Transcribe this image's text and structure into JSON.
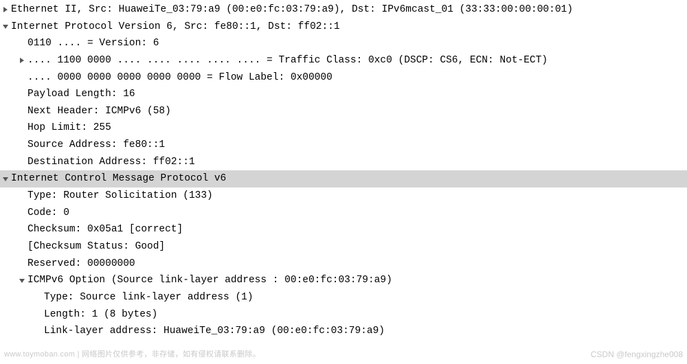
{
  "rows": [
    {
      "level": 0,
      "toggle": "collapsed",
      "text": "Ethernet II, Src: HuaweiTe_03:79:a9 (00:e0:fc:03:79:a9), Dst: IPv6mcast_01 (33:33:00:00:00:01)",
      "selected": false
    },
    {
      "level": 0,
      "toggle": "expanded",
      "text": "Internet Protocol Version 6, Src: fe80::1, Dst: ff02::1",
      "selected": false
    },
    {
      "level": 1,
      "toggle": "none",
      "text": "0110 .... = Version: 6",
      "selected": false
    },
    {
      "level": 1,
      "toggle": "collapsed",
      "text": ".... 1100 0000 .... .... .... .... .... = Traffic Class: 0xc0 (DSCP: CS6, ECN: Not-ECT)",
      "selected": false
    },
    {
      "level": 1,
      "toggle": "none",
      "text": ".... 0000 0000 0000 0000 0000 = Flow Label: 0x00000",
      "selected": false
    },
    {
      "level": 1,
      "toggle": "none",
      "text": "Payload Length: 16",
      "selected": false
    },
    {
      "level": 1,
      "toggle": "none",
      "text": "Next Header: ICMPv6 (58)",
      "selected": false
    },
    {
      "level": 1,
      "toggle": "none",
      "text": "Hop Limit: 255",
      "selected": false
    },
    {
      "level": 1,
      "toggle": "none",
      "text": "Source Address: fe80::1",
      "selected": false
    },
    {
      "level": 1,
      "toggle": "none",
      "text": "Destination Address: ff02::1",
      "selected": false
    },
    {
      "level": 0,
      "toggle": "expanded",
      "text": "Internet Control Message Protocol v6",
      "selected": true
    },
    {
      "level": 1,
      "toggle": "none",
      "text": "Type: Router Solicitation (133)",
      "selected": false
    },
    {
      "level": 1,
      "toggle": "none",
      "text": "Code: 0",
      "selected": false
    },
    {
      "level": 1,
      "toggle": "none",
      "text": "Checksum: 0x05a1 [correct]",
      "selected": false
    },
    {
      "level": 1,
      "toggle": "none",
      "text": "[Checksum Status: Good]",
      "selected": false
    },
    {
      "level": 1,
      "toggle": "none",
      "text": "Reserved: 00000000",
      "selected": false
    },
    {
      "level": 1,
      "toggle": "expanded",
      "text": "ICMPv6 Option (Source link-layer address : 00:e0:fc:03:79:a9)",
      "selected": false
    },
    {
      "level": 2,
      "toggle": "none",
      "text": "Type: Source link-layer address (1)",
      "selected": false
    },
    {
      "level": 2,
      "toggle": "none",
      "text": "Length: 1 (8 bytes)",
      "selected": false
    },
    {
      "level": 2,
      "toggle": "none",
      "text": "Link-layer address: HuaweiTe_03:79:a9 (00:e0:fc:03:79:a9)",
      "selected": false
    }
  ],
  "watermark_left": "www.toymoban.com | 网络图片仅供参考，非存储，如有侵权请联系删除。",
  "watermark_right": "CSDN @fengxingzhe008"
}
